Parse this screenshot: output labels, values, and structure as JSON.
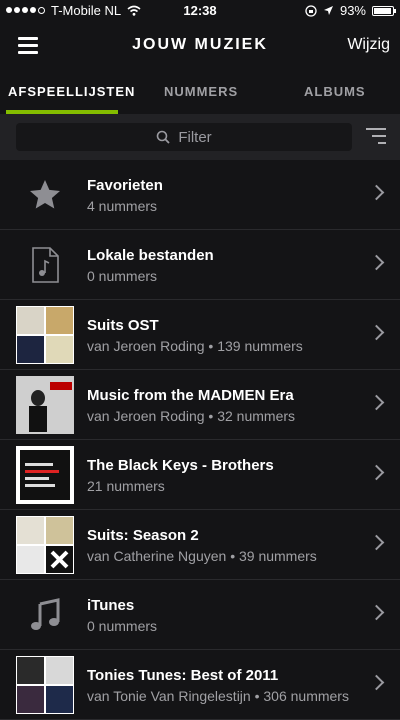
{
  "status": {
    "carrier": "T-Mobile NL",
    "time": "12:38",
    "battery": "93%",
    "battery_level": 0.93
  },
  "nav": {
    "title": "JOUW MUZIEK",
    "action": "Wijzig"
  },
  "tabs": [
    {
      "label": "AFSPEELLIJSTEN",
      "active": true
    },
    {
      "label": "NUMMERS",
      "active": false
    },
    {
      "label": "ALBUMS",
      "active": false
    }
  ],
  "filter": {
    "placeholder": "Filter"
  },
  "playlists": [
    {
      "title": "Favorieten",
      "subtitle": "4 nummers",
      "icon": "star-icon"
    },
    {
      "title": "Lokale bestanden",
      "subtitle": "0 nummers",
      "icon": "file-music-icon"
    },
    {
      "title": "Suits OST",
      "subtitle": "van Jeroen Roding • 139 nummers",
      "icon": "album-collage"
    },
    {
      "title": "Music from the MADMEN Era",
      "subtitle": "van Jeroen Roding • 32 nummers",
      "icon": "album-cover"
    },
    {
      "title": "The Black Keys - Brothers",
      "subtitle": "21 nummers",
      "icon": "album-cover"
    },
    {
      "title": "Suits: Season 2",
      "subtitle": "van Catherine Nguyen • 39 nummers",
      "icon": "album-collage"
    },
    {
      "title": "iTunes",
      "subtitle": "0 nummers",
      "icon": "music-note-icon"
    },
    {
      "title": "Tonies Tunes: Best of 2011",
      "subtitle": "van Tonie Van Ringelestijn • 306 nummers",
      "icon": "album-collage"
    }
  ],
  "colors": {
    "accent": "#84bd00",
    "background": "#141416"
  }
}
